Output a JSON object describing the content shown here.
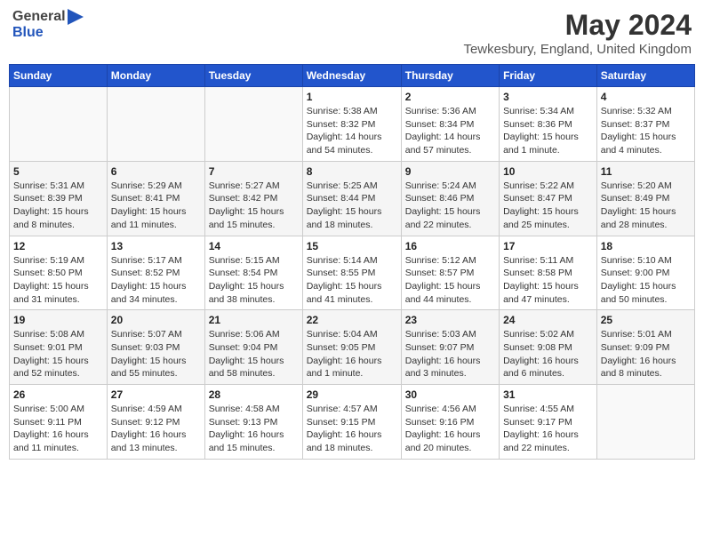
{
  "header": {
    "logo_general": "General",
    "logo_blue": "Blue",
    "month_year": "May 2024",
    "location": "Tewkesbury, England, United Kingdom"
  },
  "days_of_week": [
    "Sunday",
    "Monday",
    "Tuesday",
    "Wednesday",
    "Thursday",
    "Friday",
    "Saturday"
  ],
  "weeks": [
    {
      "days": [
        {
          "number": "",
          "info": ""
        },
        {
          "number": "",
          "info": ""
        },
        {
          "number": "",
          "info": ""
        },
        {
          "number": "1",
          "info": "Sunrise: 5:38 AM\nSunset: 8:32 PM\nDaylight: 14 hours\nand 54 minutes."
        },
        {
          "number": "2",
          "info": "Sunrise: 5:36 AM\nSunset: 8:34 PM\nDaylight: 14 hours\nand 57 minutes."
        },
        {
          "number": "3",
          "info": "Sunrise: 5:34 AM\nSunset: 8:36 PM\nDaylight: 15 hours\nand 1 minute."
        },
        {
          "number": "4",
          "info": "Sunrise: 5:32 AM\nSunset: 8:37 PM\nDaylight: 15 hours\nand 4 minutes."
        }
      ]
    },
    {
      "days": [
        {
          "number": "5",
          "info": "Sunrise: 5:31 AM\nSunset: 8:39 PM\nDaylight: 15 hours\nand 8 minutes."
        },
        {
          "number": "6",
          "info": "Sunrise: 5:29 AM\nSunset: 8:41 PM\nDaylight: 15 hours\nand 11 minutes."
        },
        {
          "number": "7",
          "info": "Sunrise: 5:27 AM\nSunset: 8:42 PM\nDaylight: 15 hours\nand 15 minutes."
        },
        {
          "number": "8",
          "info": "Sunrise: 5:25 AM\nSunset: 8:44 PM\nDaylight: 15 hours\nand 18 minutes."
        },
        {
          "number": "9",
          "info": "Sunrise: 5:24 AM\nSunset: 8:46 PM\nDaylight: 15 hours\nand 22 minutes."
        },
        {
          "number": "10",
          "info": "Sunrise: 5:22 AM\nSunset: 8:47 PM\nDaylight: 15 hours\nand 25 minutes."
        },
        {
          "number": "11",
          "info": "Sunrise: 5:20 AM\nSunset: 8:49 PM\nDaylight: 15 hours\nand 28 minutes."
        }
      ]
    },
    {
      "days": [
        {
          "number": "12",
          "info": "Sunrise: 5:19 AM\nSunset: 8:50 PM\nDaylight: 15 hours\nand 31 minutes."
        },
        {
          "number": "13",
          "info": "Sunrise: 5:17 AM\nSunset: 8:52 PM\nDaylight: 15 hours\nand 34 minutes."
        },
        {
          "number": "14",
          "info": "Sunrise: 5:15 AM\nSunset: 8:54 PM\nDaylight: 15 hours\nand 38 minutes."
        },
        {
          "number": "15",
          "info": "Sunrise: 5:14 AM\nSunset: 8:55 PM\nDaylight: 15 hours\nand 41 minutes."
        },
        {
          "number": "16",
          "info": "Sunrise: 5:12 AM\nSunset: 8:57 PM\nDaylight: 15 hours\nand 44 minutes."
        },
        {
          "number": "17",
          "info": "Sunrise: 5:11 AM\nSunset: 8:58 PM\nDaylight: 15 hours\nand 47 minutes."
        },
        {
          "number": "18",
          "info": "Sunrise: 5:10 AM\nSunset: 9:00 PM\nDaylight: 15 hours\nand 50 minutes."
        }
      ]
    },
    {
      "days": [
        {
          "number": "19",
          "info": "Sunrise: 5:08 AM\nSunset: 9:01 PM\nDaylight: 15 hours\nand 52 minutes."
        },
        {
          "number": "20",
          "info": "Sunrise: 5:07 AM\nSunset: 9:03 PM\nDaylight: 15 hours\nand 55 minutes."
        },
        {
          "number": "21",
          "info": "Sunrise: 5:06 AM\nSunset: 9:04 PM\nDaylight: 15 hours\nand 58 minutes."
        },
        {
          "number": "22",
          "info": "Sunrise: 5:04 AM\nSunset: 9:05 PM\nDaylight: 16 hours\nand 1 minute."
        },
        {
          "number": "23",
          "info": "Sunrise: 5:03 AM\nSunset: 9:07 PM\nDaylight: 16 hours\nand 3 minutes."
        },
        {
          "number": "24",
          "info": "Sunrise: 5:02 AM\nSunset: 9:08 PM\nDaylight: 16 hours\nand 6 minutes."
        },
        {
          "number": "25",
          "info": "Sunrise: 5:01 AM\nSunset: 9:09 PM\nDaylight: 16 hours\nand 8 minutes."
        }
      ]
    },
    {
      "days": [
        {
          "number": "26",
          "info": "Sunrise: 5:00 AM\nSunset: 9:11 PM\nDaylight: 16 hours\nand 11 minutes."
        },
        {
          "number": "27",
          "info": "Sunrise: 4:59 AM\nSunset: 9:12 PM\nDaylight: 16 hours\nand 13 minutes."
        },
        {
          "number": "28",
          "info": "Sunrise: 4:58 AM\nSunset: 9:13 PM\nDaylight: 16 hours\nand 15 minutes."
        },
        {
          "number": "29",
          "info": "Sunrise: 4:57 AM\nSunset: 9:15 PM\nDaylight: 16 hours\nand 18 minutes."
        },
        {
          "number": "30",
          "info": "Sunrise: 4:56 AM\nSunset: 9:16 PM\nDaylight: 16 hours\nand 20 minutes."
        },
        {
          "number": "31",
          "info": "Sunrise: 4:55 AM\nSunset: 9:17 PM\nDaylight: 16 hours\nand 22 minutes."
        },
        {
          "number": "",
          "info": ""
        }
      ]
    }
  ]
}
